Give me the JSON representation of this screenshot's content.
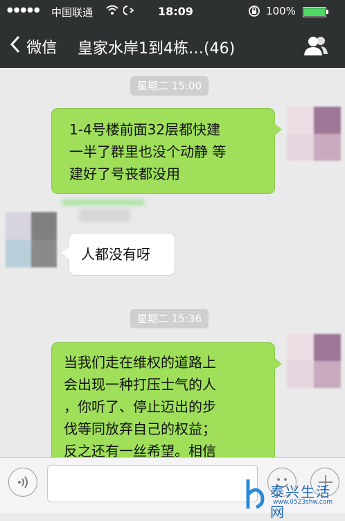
{
  "status_bar": {
    "signal": "●●●●●",
    "carrier": "中国联通",
    "time": "18:09",
    "battery": "100%"
  },
  "nav": {
    "back_label": "微信",
    "title": "皇家水岸1到4栋…(46)"
  },
  "chat": {
    "time_labels": [
      "星期二 15:00",
      "星期二 15:36"
    ],
    "messages": [
      {
        "side": "out",
        "text": "1-4号楼前面32层都快建\n一半了群里也没个动静 等\n建好了号丧都没用"
      },
      {
        "side": "in",
        "text": "人都没有呀"
      },
      {
        "side": "out",
        "text": "当我们走在维权的道路上\n会出现一种打压士气的人\n，你听了、停止迈出的步\n伐等同放弃自己的权益；\n反之还有一丝希望。相信"
      }
    ]
  },
  "input": {
    "value": "",
    "placeholder": ""
  },
  "watermark": {
    "name": "泰兴生活网",
    "url": "www.0523shw.com"
  },
  "colors": {
    "nav_bg": "#2e3132",
    "chat_bg": "#eaeaea",
    "bubble_out": "#9fdf5a",
    "bubble_in": "#ffffff",
    "battery": "#4cd964",
    "watermark": "#1a63b6"
  },
  "icons": {
    "back": "chevron-left-icon",
    "profile": "group-profile-icon",
    "voice": "voice-icon",
    "emoji": "emoji-icon",
    "plus": "plus-icon"
  }
}
